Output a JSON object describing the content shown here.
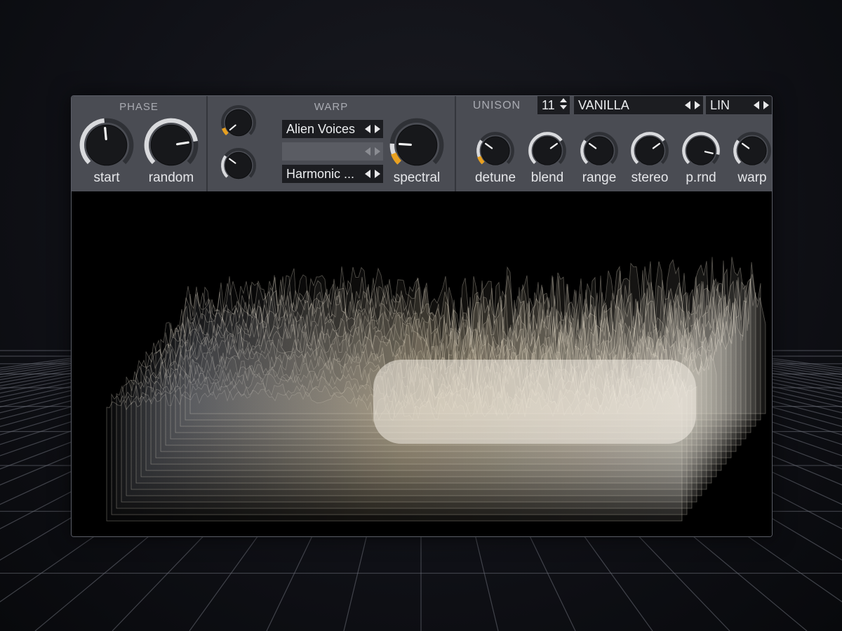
{
  "phase": {
    "title": "PHASE",
    "knobs": [
      {
        "label": "start",
        "value": 0.48
      },
      {
        "label": "random",
        "value": 0.8
      }
    ]
  },
  "warp": {
    "title": "WARP",
    "small_knobs": [
      {
        "value": 0.02,
        "mod": true
      },
      {
        "value": 0.3,
        "mod": false
      }
    ],
    "selectors": [
      "Alien Voices",
      "",
      "Harmonic ..."
    ],
    "spectral": {
      "label": "spectral",
      "value": 0.18,
      "mod": true
    }
  },
  "unison": {
    "title": "UNISON",
    "voices": "11",
    "mode": "VANILLA",
    "spread": "LIN",
    "knobs": [
      {
        "label": "detune",
        "value": 0.3,
        "mod": true
      },
      {
        "label": "blend",
        "value": 0.7,
        "mod": false
      },
      {
        "label": "range",
        "value": 0.3,
        "mod": false
      },
      {
        "label": "stereo",
        "value": 0.7,
        "mod": false
      },
      {
        "label": "p.rnd",
        "value": 0.88,
        "mod": false
      },
      {
        "label": "warp",
        "value": 0.3,
        "mod": false
      }
    ]
  },
  "colors": {
    "accent": "#e8a020",
    "header_bg": "#4a4c53",
    "panel_bg": "#000000"
  }
}
